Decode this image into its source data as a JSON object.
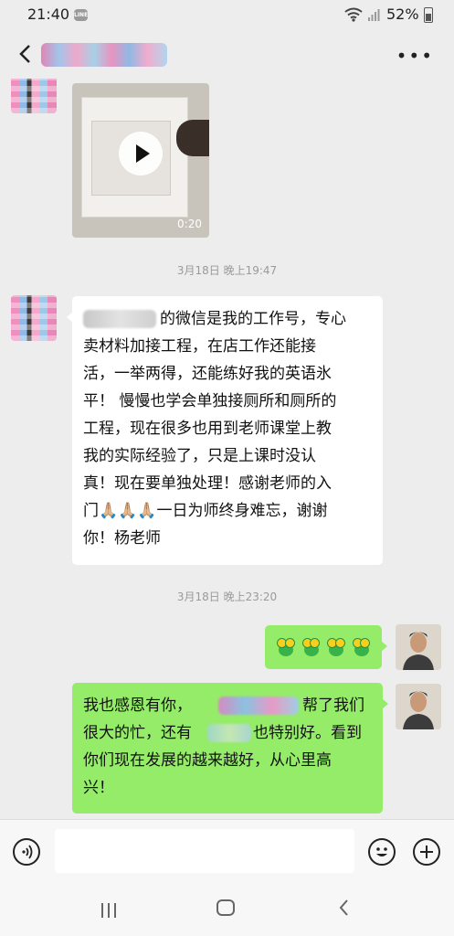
{
  "status_bar": {
    "time": "21:40",
    "notification_app": "LINE",
    "battery": "52%",
    "battery_level": 0.52
  },
  "header": {
    "back_icon": "chevron-left-icon",
    "more_icon": "ellipsis-icon"
  },
  "messages": [
    {
      "type": "video",
      "from": "contact",
      "duration": "0:20"
    },
    {
      "type": "timestamp",
      "text": "3月18日 晚上19:47"
    },
    {
      "type": "text",
      "from": "contact",
      "lines": [
        "的微信是我的工作号，专心",
        "卖材料加接工程，在店工作还能接",
        "活，一举两得，还能练好我的英语氷",
        "平！ 慢慢也学会单独接厕所和厕所的",
        "工程，现在很多也用到老师课堂上教",
        "我的实际经验了，只是上课时没认",
        "真！现在要单独处理！感谢老师的入",
        "门🙏🏼🙏🏼🙏🏼一日为师终身难忘，谢谢",
        "你！杨老师"
      ]
    },
    {
      "type": "timestamp",
      "text": "3月18日 晚上23:20"
    },
    {
      "type": "stickers",
      "from": "me",
      "count": 4,
      "sticker_icon": "frog-emoji-icon"
    },
    {
      "type": "text",
      "from": "me",
      "lines": [
        "我也感恩有你，",
        "帮了我们",
        "很大的忙，还有",
        "也特别好。看到",
        "你们现在发展的越来越好，从心里高",
        "兴！"
      ]
    }
  ],
  "input_bar": {
    "voice_icon": "voice-icon",
    "emoji_icon": "emoji-icon",
    "plus_icon": "plus-icon",
    "value": ""
  },
  "system_nav": {
    "recent_icon": "recent-apps-icon",
    "home_icon": "home-icon",
    "back_icon": "back-icon"
  },
  "colors": {
    "background": "#ededed",
    "outgoing_bubble": "#95ec69",
    "incoming_bubble": "#ffffff",
    "timestamp": "#9a9a9a"
  }
}
